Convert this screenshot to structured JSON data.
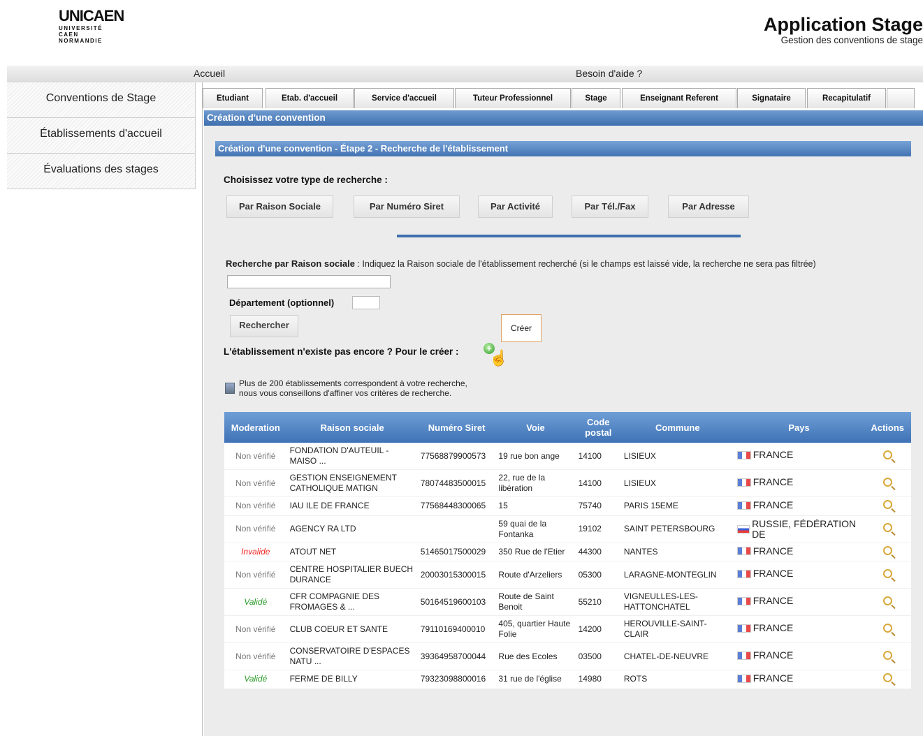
{
  "header": {
    "logo_mark": "UNICAEN",
    "logo_sub": [
      "UNIVERSITÉ",
      "CAEN",
      "NORMANDIE"
    ],
    "app_title": "Application Stage",
    "app_subtitle": "Gestion des conventions de stage"
  },
  "topbar": {
    "home": "Accueil",
    "help": "Besoin d'aide ?"
  },
  "sidebar": {
    "items": [
      {
        "label": "Conventions de Stage"
      },
      {
        "label": "Établissements d'accueil"
      },
      {
        "label": "Évaluations des stages"
      }
    ]
  },
  "tabs": [
    {
      "label": "Etudiant"
    },
    {
      "label": "Etab. d'accueil"
    },
    {
      "label": "Service d'accueil"
    },
    {
      "label": "Tuteur Professionnel"
    },
    {
      "label": "Stage"
    },
    {
      "label": "Enseignant Referent"
    },
    {
      "label": "Signataire"
    },
    {
      "label": "Recapitulatif"
    },
    {
      "label": ""
    }
  ],
  "panel": {
    "title": "Création d'une convention",
    "subtitle": "Création d'une convention - Étape 2 - Recherche de l'établissement",
    "choose_label": "Choisissez votre type de recherche :",
    "search_types": [
      {
        "label": "Par Raison Sociale"
      },
      {
        "label": "Par Numéro Siret"
      },
      {
        "label": "Par Activité"
      },
      {
        "label": "Par Tél./Fax"
      },
      {
        "label": "Par Adresse"
      }
    ],
    "rs_label_bold": "Recherche par Raison sociale",
    "rs_label_rest": " : Indiquez la Raison sociale de l'établissement recherché (si le champs est laissé vide, la recherche ne sera pas filtrée)",
    "rs_value": "",
    "dept_label": "Département (optionnel)",
    "dept_value": "",
    "search_button": "Rechercher",
    "create_button": "Créer",
    "create_prompt": "L'établissement n'existe pas encore ? Pour le créer :",
    "info_line1": "Plus de 200 établissements correspondent à votre recherche,",
    "info_line2": "nous vous conseillons d'affiner vos critères de recherche."
  },
  "table": {
    "columns": [
      "Moderation",
      "Raison sociale",
      "Numéro Siret",
      "Voie",
      "Code postal",
      "Commune",
      "Pays",
      "Actions"
    ],
    "rows": [
      {
        "moderation": "Non vérifié",
        "status": "nv",
        "raison": "FONDATION D'AUTEUIL - MAISO ...",
        "siret": "77568879900573",
        "voie": "19 rue bon ange",
        "cp": "14100",
        "commune": "LISIEUX",
        "pays": "FRANCE",
        "flag": "fr"
      },
      {
        "moderation": "Non vérifié",
        "status": "nv",
        "raison": "GESTION ENSEIGNEMENT CATHOLIQUE MATIGN",
        "siret": "78074483500015",
        "voie": "22, rue de la libération",
        "cp": "14100",
        "commune": "LISIEUX",
        "pays": "FRANCE",
        "flag": "fr"
      },
      {
        "moderation": "Non vérifié",
        "status": "nv",
        "raison": "IAU ILE DE FRANCE",
        "siret": "77568448300065",
        "voie": "15",
        "cp": "75740",
        "commune": "PARIS 15EME",
        "pays": "FRANCE",
        "flag": "fr"
      },
      {
        "moderation": "Non vérifié",
        "status": "nv",
        "raison": "AGENCY RA LTD",
        "siret": "",
        "voie": "59 quai de la Fontanka",
        "cp": "19102",
        "commune": "SAINT PETERSBOURG",
        "pays": "RUSSIE, FÉDÉRATION DE",
        "flag": "ru"
      },
      {
        "moderation": "Invalide",
        "status": "invalide",
        "raison": "ATOUT NET",
        "siret": "51465017500029",
        "voie": "350 Rue de l'Etier",
        "cp": "44300",
        "commune": "NANTES",
        "pays": "FRANCE",
        "flag": "fr"
      },
      {
        "moderation": "Non vérifié",
        "status": "nv",
        "raison": "CENTRE HOSPITALIER BUECH DURANCE",
        "siret": "20003015300015",
        "voie": "Route d'Arzeliers",
        "cp": "05300",
        "commune": "LARAGNE-MONTEGLIN",
        "pays": "FRANCE",
        "flag": "fr"
      },
      {
        "moderation": "Validé",
        "status": "valide",
        "raison": "CFR COMPAGNIE DES FROMAGES & ...",
        "siret": "50164519600103",
        "voie": "Route de Saint Benoit",
        "cp": "55210",
        "commune": "VIGNEULLES-LES-HATTONCHATEL",
        "pays": "FRANCE",
        "flag": "fr"
      },
      {
        "moderation": "Non vérifié",
        "status": "nv",
        "raison": "CLUB COEUR ET SANTE",
        "siret": "79110169400010",
        "voie": "405, quartier Haute Folie",
        "cp": "14200",
        "commune": "HEROUVILLE-SAINT-CLAIR",
        "pays": "FRANCE",
        "flag": "fr"
      },
      {
        "moderation": "Non vérifié",
        "status": "nv",
        "raison": "CONSERVATOIRE D'ESPACES NATU ...",
        "siret": "39364958700044",
        "voie": "Rue des Ecoles",
        "cp": "03500",
        "commune": "CHATEL-DE-NEUVRE",
        "pays": "FRANCE",
        "flag": "fr"
      },
      {
        "moderation": "Validé",
        "status": "valide",
        "raison": "FERME DE BILLY",
        "siret": "79323098800016",
        "voie": "31 rue de l'église",
        "cp": "14980",
        "commune": "ROTS",
        "pays": "FRANCE",
        "flag": "fr"
      }
    ]
  }
}
